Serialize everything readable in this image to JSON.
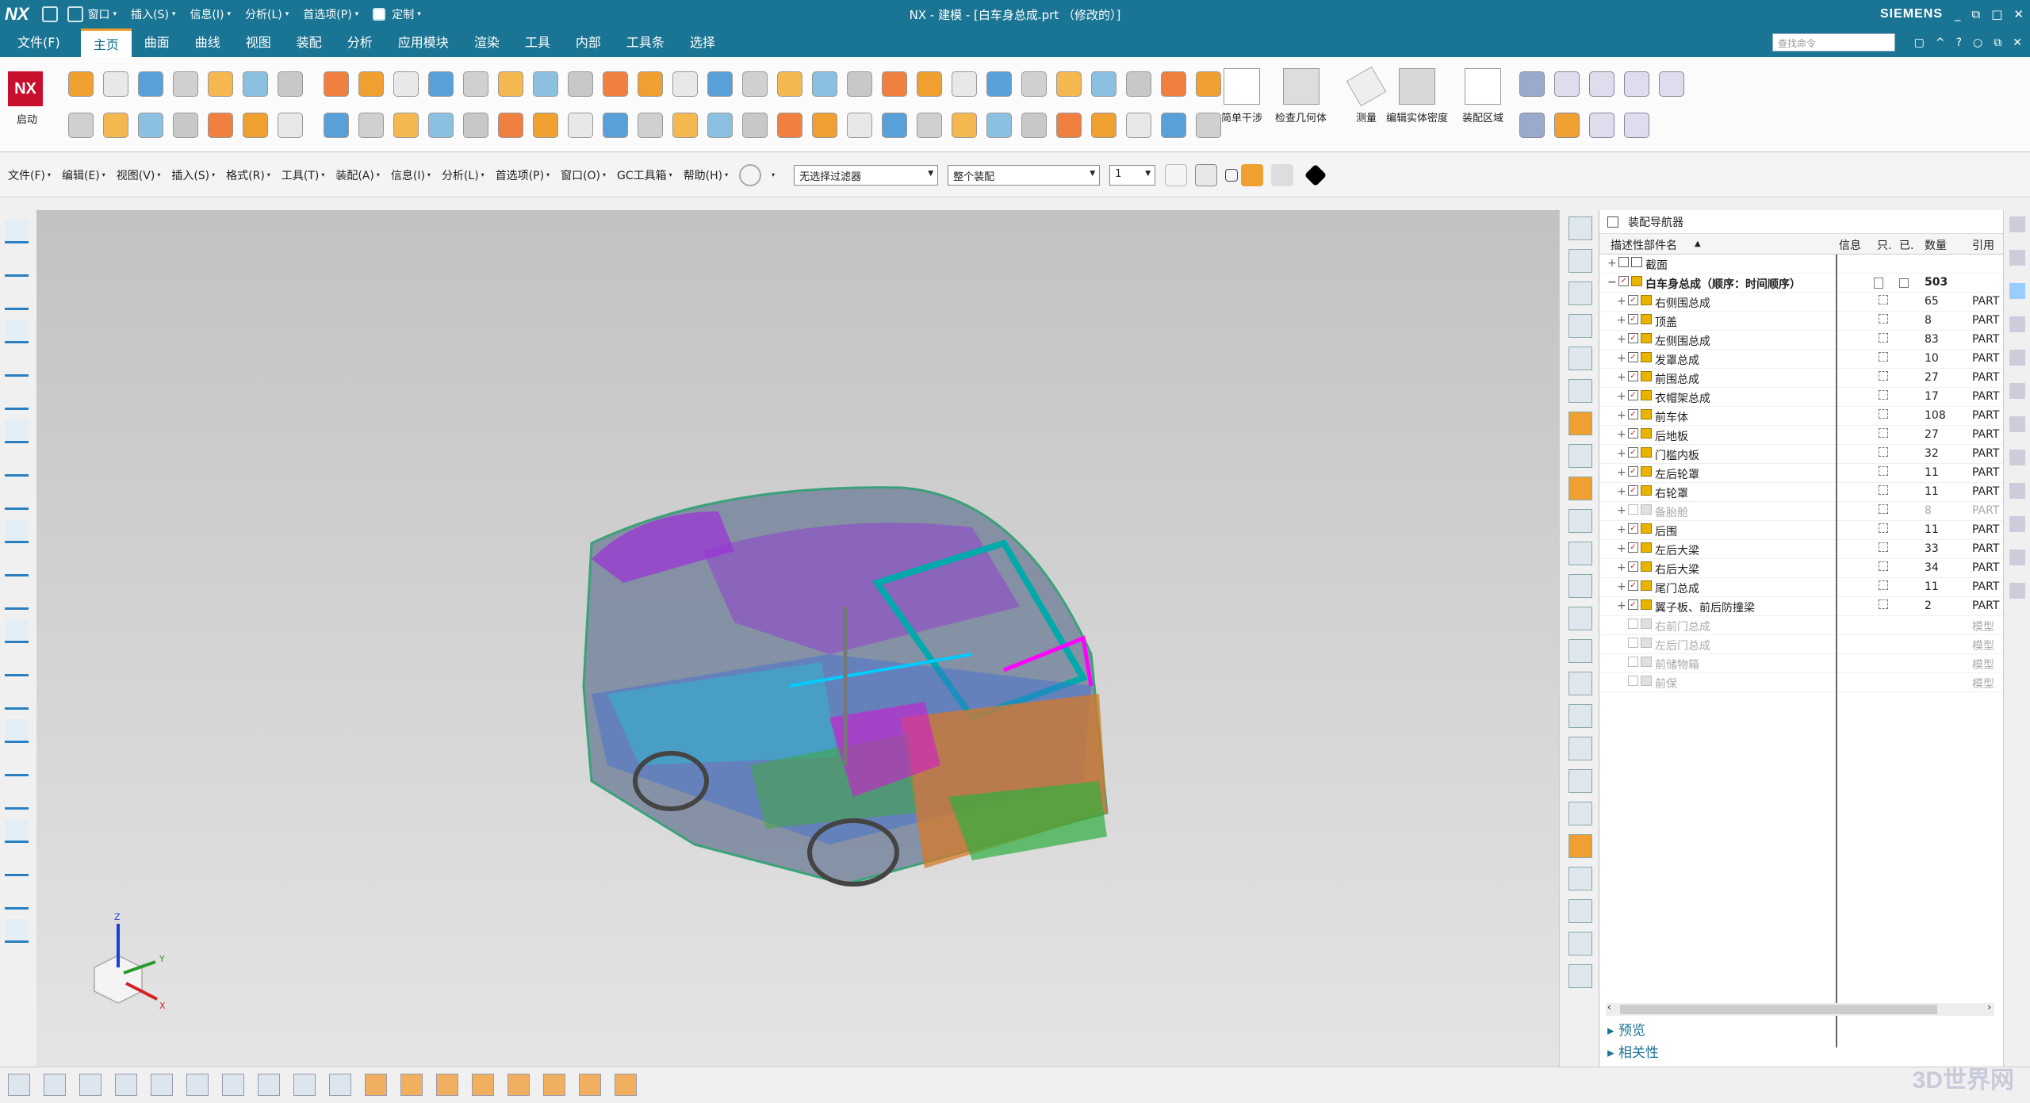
{
  "titlebar": {
    "app_logo": "NX",
    "menus": [
      "窗口",
      "插入(S)",
      "信息(I)",
      "分析(L)",
      "首选项(P)",
      "定制"
    ],
    "title": "NX - 建模 - [白车身总成.prt （修改的）]",
    "brand": "SIEMENS",
    "window_buttons": [
      "_",
      "⧉",
      "□",
      "✕"
    ]
  },
  "menubar": {
    "items": [
      "文件(F)",
      "主页",
      "曲面",
      "曲线",
      "视图",
      "装配",
      "分析",
      "应用模块",
      "渲染",
      "工具",
      "内部",
      "工具条",
      "选择"
    ],
    "active_index": 1,
    "search_placeholder": "查找命令",
    "right_icons": [
      "▢",
      "^",
      "?",
      "○",
      "⧉",
      "✕"
    ]
  },
  "ribbon": {
    "start_logo": "NX",
    "start_label": "启动",
    "big_buttons": [
      "简单干涉",
      "检查几何体",
      "测量",
      "编辑实体密度",
      "装配区域"
    ]
  },
  "cmdbar": {
    "menus": [
      "文件(F)",
      "编辑(E)",
      "视图(V)",
      "插入(S)",
      "格式(R)",
      "工具(T)",
      "装配(A)",
      "信息(I)",
      "分析(L)",
      "首选项(P)",
      "窗口(O)",
      "GC工具箱",
      "帮助(H)"
    ],
    "filter": "无选择过滤器",
    "scope": "整个装配",
    "level": "1"
  },
  "navigator": {
    "title": "装配导航器",
    "columns": [
      "描述性部件名",
      "信息",
      "只.",
      "已.",
      "数量",
      "引用"
    ],
    "section_row": "截面",
    "root": {
      "name": "白车身总成（顺序：时间顺序）",
      "qty": "503"
    },
    "rows": [
      {
        "name": "右侧围总成",
        "qty": "65",
        "ref": "PART",
        "checked": true
      },
      {
        "name": "顶盖",
        "qty": "8",
        "ref": "PART",
        "checked": true
      },
      {
        "name": "左侧围总成",
        "qty": "83",
        "ref": "PART",
        "checked": true
      },
      {
        "name": "发罩总成",
        "qty": "10",
        "ref": "PART",
        "checked": true
      },
      {
        "name": "前围总成",
        "qty": "27",
        "ref": "PART",
        "checked": true
      },
      {
        "name": "衣帽架总成",
        "qty": "17",
        "ref": "PART",
        "checked": true
      },
      {
        "name": "前车体",
        "qty": "108",
        "ref": "PART",
        "checked": true
      },
      {
        "name": "后地板",
        "qty": "27",
        "ref": "PART",
        "checked": true
      },
      {
        "name": "门槛内板",
        "qty": "32",
        "ref": "PART",
        "checked": true
      },
      {
        "name": "左后轮罩",
        "qty": "11",
        "ref": "PART",
        "checked": true
      },
      {
        "name": "右轮罩",
        "qty": "11",
        "ref": "PART",
        "checked": true
      },
      {
        "name": "备胎舱",
        "qty": "8",
        "ref": "PART",
        "checked": false
      },
      {
        "name": "后围",
        "qty": "11",
        "ref": "PART",
        "checked": true
      },
      {
        "name": "左后大梁",
        "qty": "33",
        "ref": "PART",
        "checked": true
      },
      {
        "name": "右后大梁",
        "qty": "34",
        "ref": "PART",
        "checked": true
      },
      {
        "name": "尾门总成",
        "qty": "11",
        "ref": "PART",
        "checked": true
      },
      {
        "name": "翼子板、前后防撞梁",
        "qty": "2",
        "ref": "PART",
        "checked": true
      },
      {
        "name": "右前门总成",
        "qty": "",
        "ref": "模型",
        "checked": false
      },
      {
        "name": "左后门总成",
        "qty": "",
        "ref": "模型",
        "checked": false
      },
      {
        "name": "前储物箱",
        "qty": "",
        "ref": "模型",
        "checked": false
      },
      {
        "name": "前保",
        "qty": "",
        "ref": "模型",
        "checked": false
      }
    ],
    "sections": [
      "预览",
      "相关性"
    ]
  },
  "triad": {
    "x": "X",
    "y": "Y",
    "z": "Z"
  },
  "watermark": "3D世界网"
}
